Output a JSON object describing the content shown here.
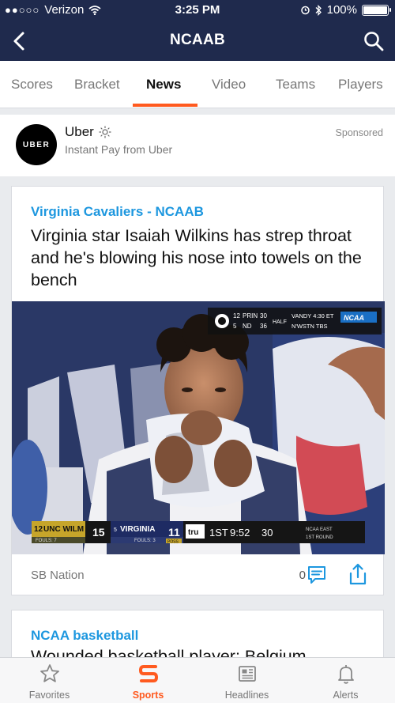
{
  "status_bar": {
    "signal_dots": "●●○○○",
    "carrier": "Verizon",
    "time": "3:25 PM",
    "battery": "100%"
  },
  "nav": {
    "title": "NCAAB"
  },
  "tabs": [
    {
      "label": "Scores",
      "active": false
    },
    {
      "label": "Bracket",
      "active": false
    },
    {
      "label": "News",
      "active": true
    },
    {
      "label": "Video",
      "active": false
    },
    {
      "label": "Teams",
      "active": false
    },
    {
      "label": "Players",
      "active": false
    }
  ],
  "ad": {
    "logo_text": "UBER",
    "name": "Uber",
    "subtitle": "Instant Pay from Uber",
    "sponsored_label": "Sponsored"
  },
  "article": {
    "category": "Virginia Cavaliers - NCAAB",
    "headline": "Virginia star Isaiah Wilkins has strep throat and he's blowing his nose into towels on the bench",
    "source": "SB Nation",
    "comment_count": "0",
    "scorebug": {
      "corner": {
        "line1_seed": "12",
        "line1_team": "PRIN",
        "line1_score": "30",
        "line2_seed": "5",
        "line2_team": "ND",
        "line2_score": "36",
        "period": "HALF",
        "game2_line1": "VANDY 4:30 ET",
        "game2_line2": "N'WSTN TBS",
        "network": "NCAA"
      },
      "left_team": "UNC WILM",
      "left_seed": "12",
      "left_score": "15",
      "left_fouls": "FOULS: 7",
      "right_team": "VIRGINIA",
      "right_seed": "5",
      "right_score": "11",
      "right_fouls": "FOULS: 3",
      "poss": "POSS",
      "sponsor": "tru",
      "period": "1ST",
      "clock": "9:52",
      "shot_clock": "30",
      "region": "NCAA EAST",
      "round": "1ST ROUND"
    }
  },
  "article2": {
    "category": "NCAA basketball",
    "headline": "Wounded basketball player: Belgium"
  },
  "bottom_nav": [
    {
      "label": "Favorites",
      "icon": "star-icon",
      "active": false
    },
    {
      "label": "Sports",
      "icon": "sports-s-icon",
      "active": true
    },
    {
      "label": "Headlines",
      "icon": "newspaper-icon",
      "active": false
    },
    {
      "label": "Alerts",
      "icon": "bell-icon",
      "active": false
    }
  ],
  "colors": {
    "header_bg": "#1f2a4d",
    "accent_orange": "#ff5a1f",
    "category_blue": "#1d97df"
  }
}
